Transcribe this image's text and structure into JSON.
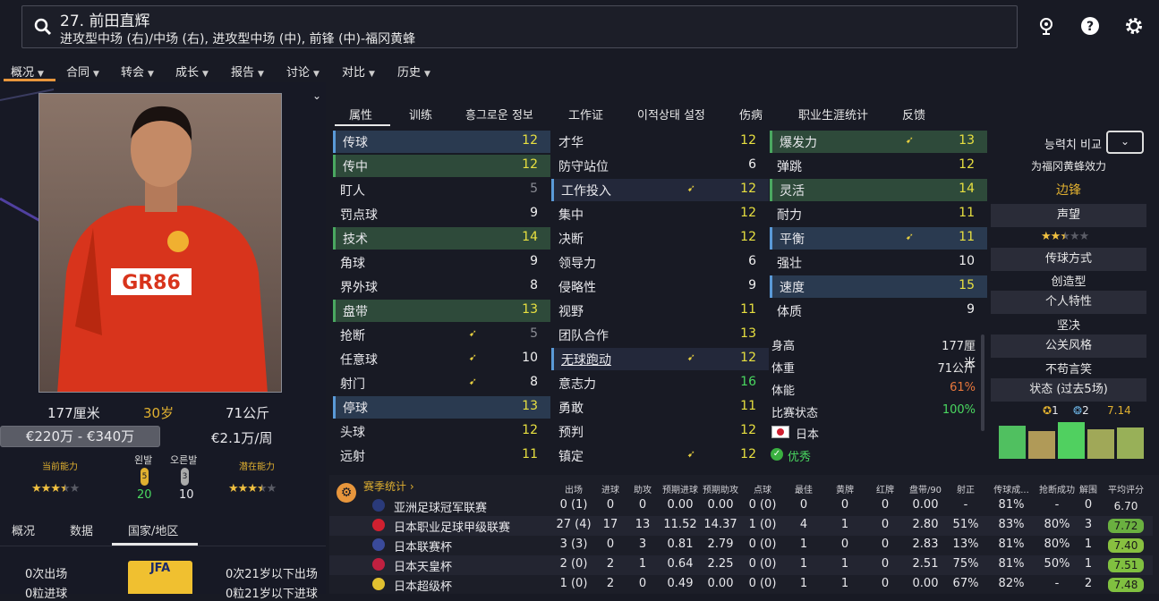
{
  "player": {
    "name": "27. 前田直辉",
    "positions": "进攻型中场 (右)/中场 (右), 进攻型中场 (中), 前锋 (中)-福冈黄蜂",
    "height": "177厘米",
    "age": "30岁",
    "weight": "71公斤",
    "value": "€220万 - €340万",
    "wage": "€2.1万/周",
    "current_ability_label": "当前能力",
    "potential_ability_label": "潜在能力",
    "current_stars": 3.5,
    "potential_stars": 3.5,
    "left_foot_label": "왼발",
    "left_foot_level": "5",
    "left_foot_value": "20",
    "right_foot_label": "오른발",
    "right_foot_level": "3",
    "right_foot_value": "10"
  },
  "nav": {
    "items": [
      "概况",
      "合同",
      "转会",
      "成长",
      "报告",
      "讨论",
      "对比",
      "历史"
    ]
  },
  "left_tabs": [
    "概况",
    "数据",
    "国家/地区"
  ],
  "international": {
    "apps": "0次出场",
    "u21_apps": "0次21岁以下出场",
    "goals": "0粒进球",
    "u21_goals": "0粒21岁以下进球",
    "badge_text": "JFA"
  },
  "right_tabs": [
    "属性",
    "训练",
    "흥그로운 정보",
    "工作证",
    "이적상태 설정",
    "伤病",
    "职业生涯统计",
    "反馈"
  ],
  "attrs_col1": [
    {
      "n": "传球",
      "v": "12",
      "hl": "blue"
    },
    {
      "n": "传中",
      "v": "12",
      "hl": "green"
    },
    {
      "n": "盯人",
      "v": "5",
      "hl": ""
    },
    {
      "n": "罚点球",
      "v": "9",
      "hl": ""
    },
    {
      "n": "技术",
      "v": "14",
      "hl": "green"
    },
    {
      "n": "角球",
      "v": "9",
      "hl": ""
    },
    {
      "n": "界外球",
      "v": "8",
      "hl": ""
    },
    {
      "n": "盘带",
      "v": "13",
      "hl": "green"
    },
    {
      "n": "抢断",
      "v": "5",
      "hl": "",
      "arrow": true
    },
    {
      "n": "任意球",
      "v": "10",
      "hl": "",
      "arrow": true
    },
    {
      "n": "射门",
      "v": "8",
      "hl": "",
      "arrow": true
    },
    {
      "n": "停球",
      "v": "13",
      "hl": "blue"
    },
    {
      "n": "头球",
      "v": "12",
      "hl": ""
    },
    {
      "n": "远射",
      "v": "11",
      "hl": ""
    }
  ],
  "attrs_col2": [
    {
      "n": "才华",
      "v": "12",
      "hl": ""
    },
    {
      "n": "防守站位",
      "v": "6",
      "hl": ""
    },
    {
      "n": "工作投入",
      "v": "12",
      "hl": "blue",
      "arrow": true
    },
    {
      "n": "集中",
      "v": "12",
      "hl": ""
    },
    {
      "n": "决断",
      "v": "12",
      "hl": ""
    },
    {
      "n": "领导力",
      "v": "6",
      "hl": ""
    },
    {
      "n": "侵略性",
      "v": "9",
      "hl": ""
    },
    {
      "n": "视野",
      "v": "11",
      "hl": ""
    },
    {
      "n": "团队合作",
      "v": "13",
      "hl": ""
    },
    {
      "n": "无球跑动",
      "v": "12",
      "hl": "blue",
      "arrow": true
    },
    {
      "n": "意志力",
      "v": "16",
      "hl": ""
    },
    {
      "n": "勇敢",
      "v": "11",
      "hl": ""
    },
    {
      "n": "预判",
      "v": "12",
      "hl": ""
    },
    {
      "n": "镇定",
      "v": "12",
      "hl": "",
      "arrow": true
    }
  ],
  "attrs_col3": [
    {
      "n": "爆发力",
      "v": "13",
      "hl": "green",
      "arrow": true
    },
    {
      "n": "弹跳",
      "v": "12",
      "hl": ""
    },
    {
      "n": "灵活",
      "v": "14",
      "hl": "green"
    },
    {
      "n": "耐力",
      "v": "11",
      "hl": ""
    },
    {
      "n": "平衡",
      "v": "11",
      "hl": "blue",
      "arrow": true
    },
    {
      "n": "强壮",
      "v": "10",
      "hl": ""
    },
    {
      "n": "速度",
      "v": "15",
      "hl": "blue"
    },
    {
      "n": "体质",
      "v": "9",
      "hl": ""
    }
  ],
  "physical_info": [
    {
      "n": "身高",
      "v": "177厘米",
      "c": "#e8e8e8"
    },
    {
      "n": "体重",
      "v": "71公斤",
      "c": "#e8e8e8"
    },
    {
      "n": "体能",
      "v": "61%",
      "c": "#e8773c"
    },
    {
      "n": "比赛状态",
      "v": "100%",
      "c": "#4ad860"
    }
  ],
  "nationality": "日本",
  "status_text": "优秀",
  "side": {
    "compare_label": "능력치 비교",
    "plays_for": "为福冈黄蜂效力",
    "role": "边锋",
    "reputation_label": "声望",
    "reputation_stars": 2.5,
    "pass_label": "传球方式",
    "pass_value": "创造型",
    "trait_label": "个人特性",
    "trait_value": "坚决",
    "media_label": "公关风格",
    "media_value": "不苟言笑",
    "form_label": "状态 (过去5场)",
    "form_goals": "1",
    "form_assists": "2",
    "form_avg": "7.14",
    "form_bars": [
      0.78,
      0.65,
      0.85,
      0.68,
      0.72
    ]
  },
  "stats": {
    "title": "赛季统计",
    "headers": [
      "出场",
      "进球",
      "助攻",
      "预期进球",
      "预期助攻",
      "点球",
      "最佳",
      "黄牌",
      "红牌",
      "盘带/90",
      "射正",
      "传球成...",
      "抢断成功",
      "解围",
      "平均评分"
    ],
    "rows": [
      {
        "comp": "亚洲足球冠军联赛",
        "vals": [
          "0 (1)",
          "0",
          "0",
          "0.00",
          "0.00",
          "0 (0)",
          "0",
          "0",
          "0",
          "0.00",
          "-",
          "81%",
          "-",
          "0"
        ],
        "rating": "6.70",
        "rc": ""
      },
      {
        "comp": "日本职业足球甲级联赛",
        "vals": [
          "27 (4)",
          "17",
          "13",
          "11.52",
          "14.37",
          "1 (0)",
          "4",
          "1",
          "0",
          "2.80",
          "51%",
          "83%",
          "80%",
          "3"
        ],
        "rating": "7.72",
        "rc": "#6ab040"
      },
      {
        "comp": "日本联赛杯",
        "vals": [
          "3 (3)",
          "0",
          "3",
          "0.81",
          "2.79",
          "0 (0)",
          "1",
          "0",
          "0",
          "2.83",
          "13%",
          "81%",
          "80%",
          "1"
        ],
        "rating": "7.40",
        "rc": "#88c040"
      },
      {
        "comp": "日本天皇杯",
        "vals": [
          "2 (0)",
          "2",
          "1",
          "0.64",
          "2.25",
          "0 (0)",
          "1",
          "1",
          "0",
          "2.51",
          "75%",
          "81%",
          "50%",
          "1"
        ],
        "rating": "7.51",
        "rc": "#80c040"
      },
      {
        "comp": "日本超级杯",
        "vals": [
          "1 (0)",
          "2",
          "0",
          "0.49",
          "0.00",
          "0 (0)",
          "1",
          "1",
          "0",
          "0.00",
          "67%",
          "82%",
          "-",
          "2"
        ],
        "rating": "7.48",
        "rc": "#80c040"
      }
    ]
  },
  "colors": {
    "accent": "#e8963c",
    "highlight": "#e0b030",
    "good": "#4ad860"
  }
}
